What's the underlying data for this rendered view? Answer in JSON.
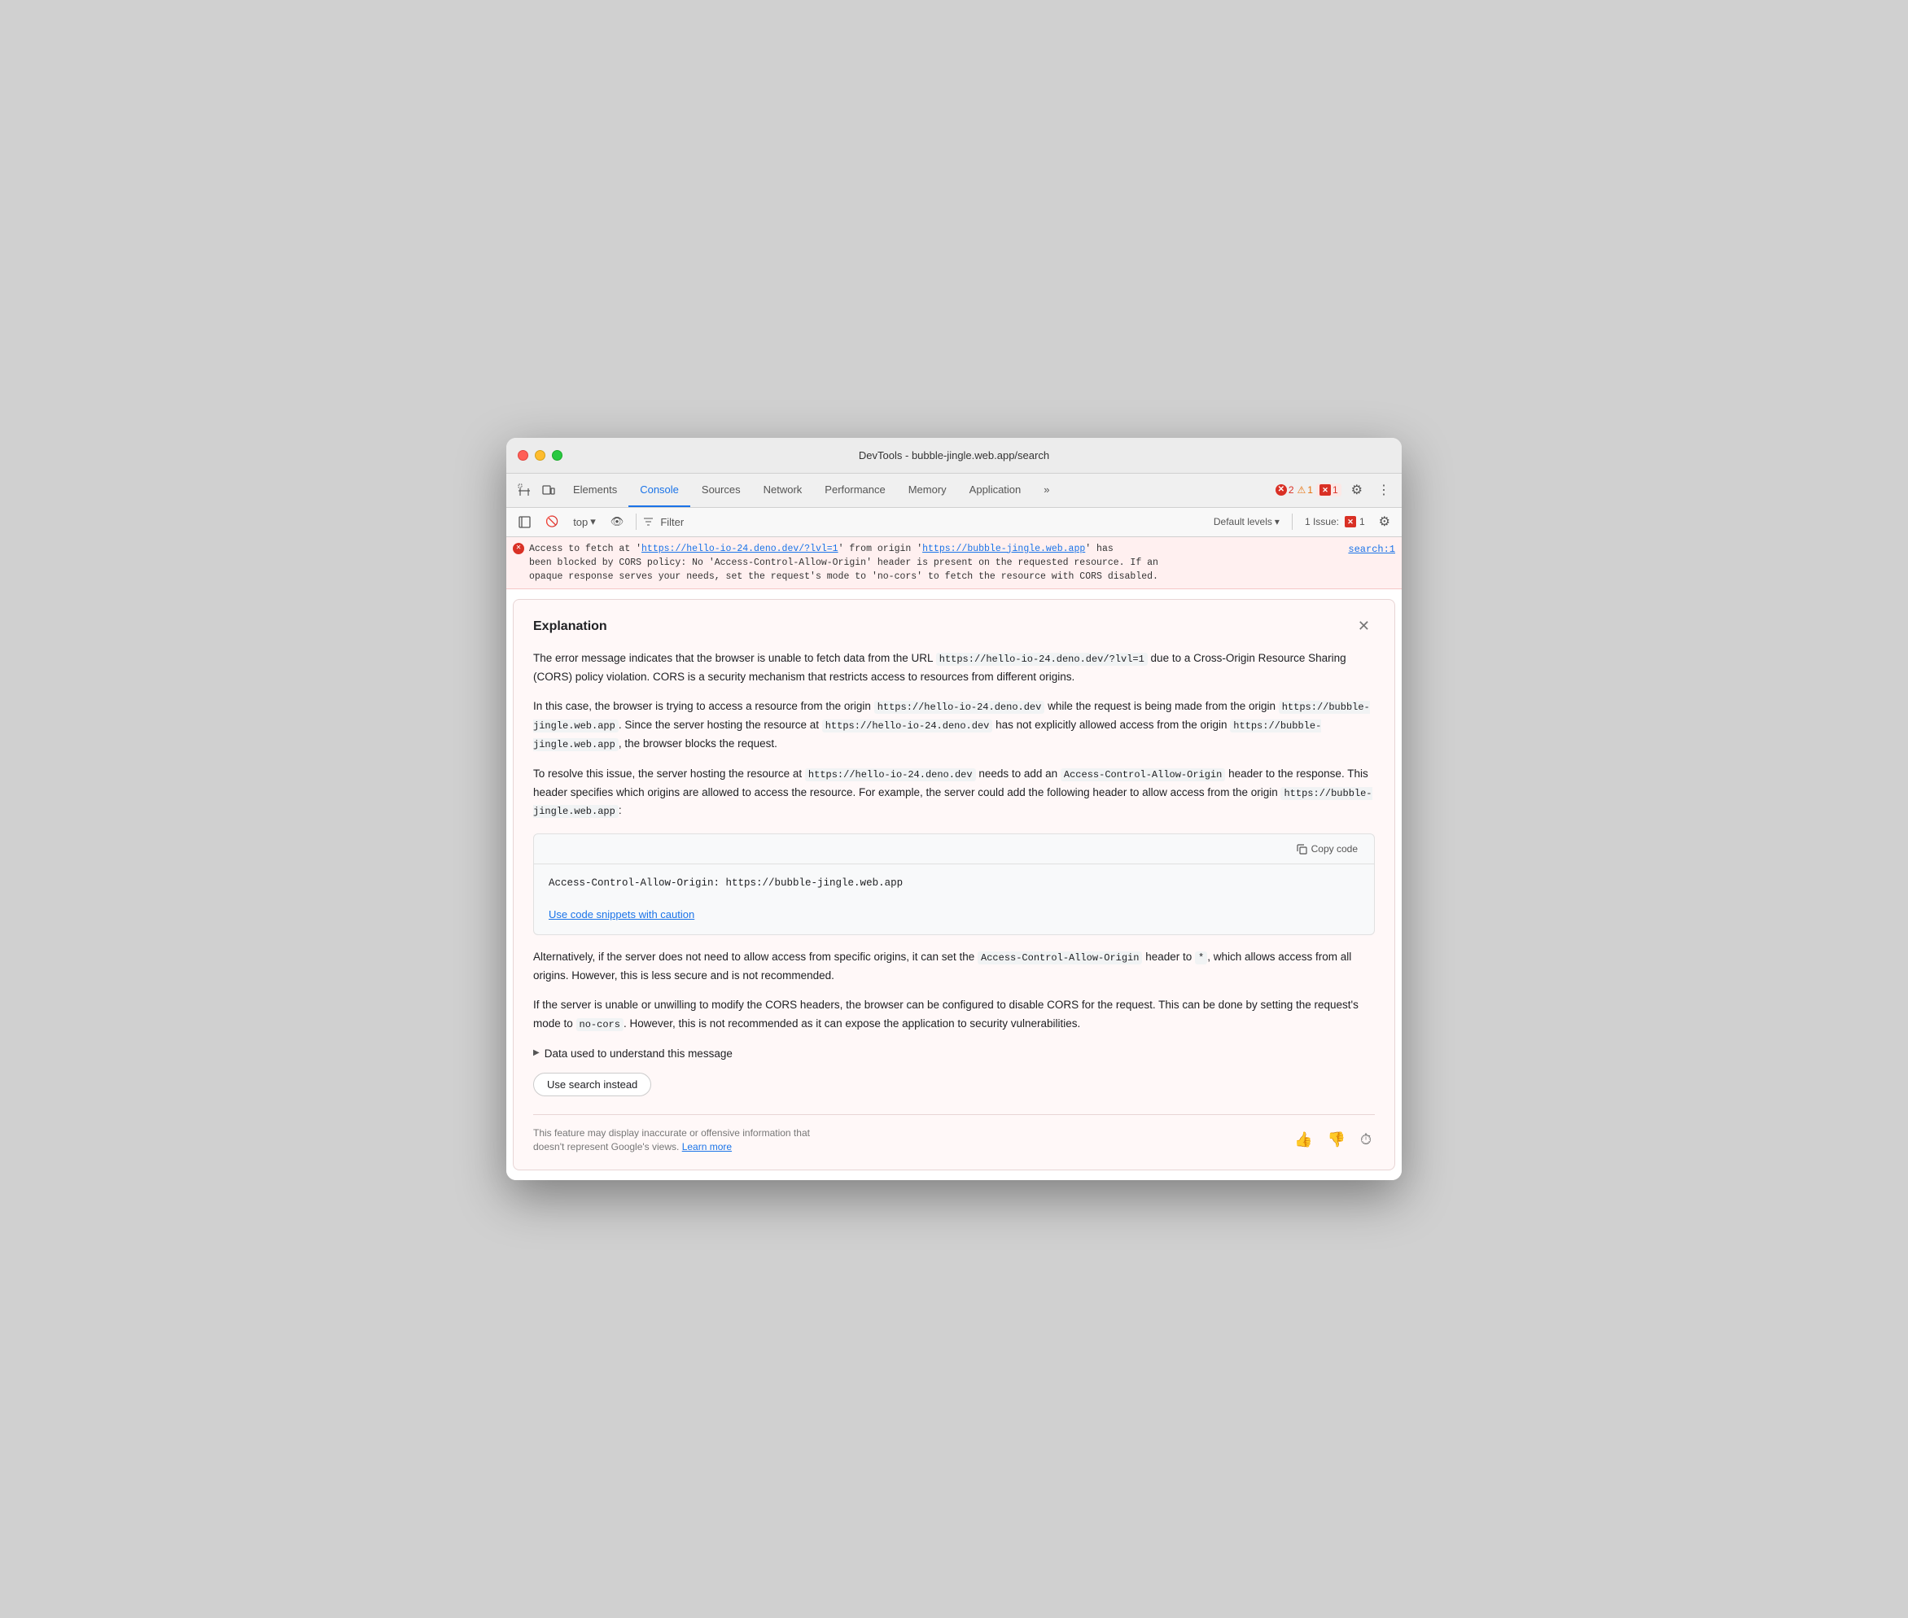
{
  "window": {
    "title": "DevTools - bubble-jingle.web.app/search"
  },
  "toolbar": {
    "tabs": [
      {
        "id": "elements",
        "label": "Elements",
        "active": false
      },
      {
        "id": "console",
        "label": "Console",
        "active": true
      },
      {
        "id": "sources",
        "label": "Sources",
        "active": false
      },
      {
        "id": "network",
        "label": "Network",
        "active": false
      },
      {
        "id": "performance",
        "label": "Performance",
        "active": false
      },
      {
        "id": "memory",
        "label": "Memory",
        "active": false
      },
      {
        "id": "application",
        "label": "Application",
        "active": false
      }
    ],
    "more_label": "»",
    "badge_error_count": "2",
    "badge_warning_count": "1",
    "badge_issue_count": "1",
    "issues_label": "1 Issue:"
  },
  "secondary_toolbar": {
    "context_label": "top",
    "filter_placeholder": "Filter",
    "levels_label": "Default levels",
    "issue_label": "1 Issue:",
    "chevron": "▾"
  },
  "error_row": {
    "text_before_link1": "Access to fetch at '",
    "link1": "https://hello-io-24.deno.dev/?lvl=1",
    "text_mid": "' from origin '",
    "link2": "https://bubble-jingle.web.app",
    "text_after": "' has been blocked by CORS policy: No 'Access-Control-Allow-Origin' header is present on the requested resource. If an opaque response serves your needs, set the request's mode to 'no-cors' to fetch the resource with CORS disabled.",
    "source_link": "search:1"
  },
  "explanation": {
    "title": "Explanation",
    "para1": "The error message indicates that the browser is unable to fetch data from the URL ",
    "para1_code": "https://hello-io-24.deno.dev/?lvl=1",
    "para1_rest": " due to a Cross-Origin Resource Sharing (CORS) policy violation. CORS is a security mechanism that restricts access to resources from different origins.",
    "para2_1": "In this case, the browser is trying to access a resource from the origin ",
    "para2_code1": "https://hello-io-24.deno.dev",
    "para2_2": " while the request is being made from the origin ",
    "para2_code2": "https://bubble-jingle.web.app",
    "para2_3": ". Since the server hosting the resource at ",
    "para2_code3": "https://hello-io-24.deno.dev",
    "para2_4": " has not explicitly allowed access from the origin ",
    "para2_code4": "https://bubble-jingle.web.app",
    "para2_5": ", the browser blocks the request.",
    "para3_1": "To resolve this issue, the server hosting the resource at ",
    "para3_code1": "https://hello-io-24.deno.dev",
    "para3_2": " needs to add an ",
    "para3_code2": "Access-Control-Allow-Origin",
    "para3_3": " header to the response. This header specifies which origins are allowed to access the resource. For example, the server could add the following header to allow access from the origin ",
    "para3_code3": "https://bubble-jingle.web.app",
    "para3_4": ":",
    "code_snippet": "Access-Control-Allow-Origin: https://bubble-jingle.web.app",
    "copy_label": "Copy code",
    "caution_link": "Use code snippets with caution",
    "para4_1": "Alternatively, if the server does not need to allow access from specific origins, it can set the ",
    "para4_code1": "Access-Control-Allow-Origin",
    "para4_2": " header to ",
    "para4_code2": "*",
    "para4_3": ", which allows access from all origins. However, this is less secure and is not recommended.",
    "para5_1": "If the server is unable or unwilling to modify the CORS headers, the browser can be configured to disable CORS for the request. This can be done by setting the request's mode to ",
    "para5_code1": "no-cors",
    "para5_2": ". However, this is not recommended as it can expose the application to security vulnerabilities.",
    "data_used_label": "Data used to understand this message",
    "use_search_label": "Use search instead",
    "disclaimer": "This feature may display inaccurate or offensive information that doesn't represent Google's views.",
    "learn_more": "Learn more"
  }
}
